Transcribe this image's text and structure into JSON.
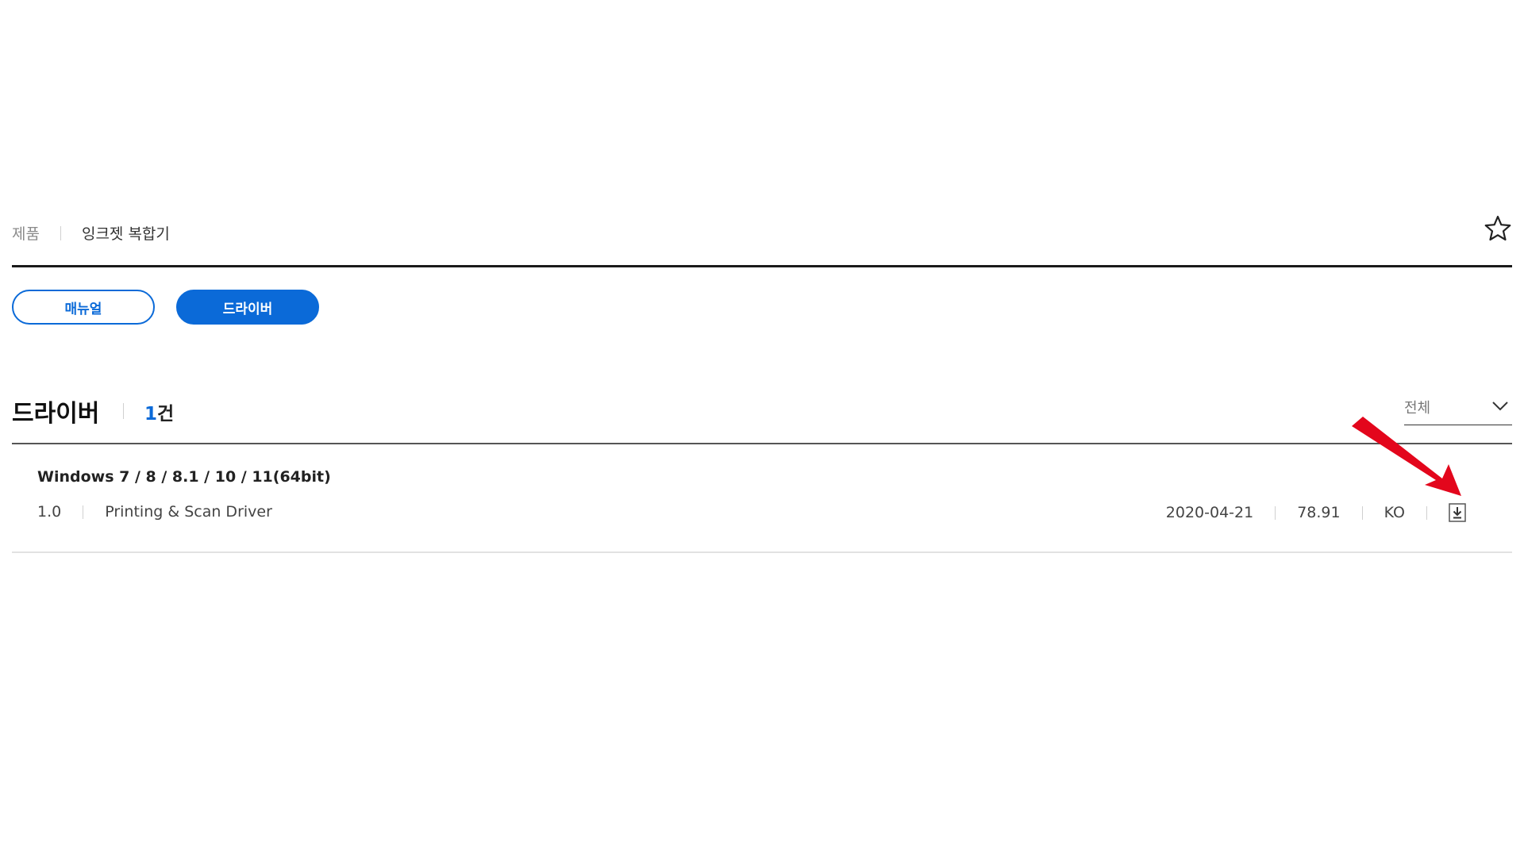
{
  "breadcrumb": {
    "root": "제품",
    "current": "잉크젯 복합기"
  },
  "favorite": {
    "icon": "star-outline-icon"
  },
  "tabs": [
    {
      "label": "매뉴얼",
      "active": false
    },
    {
      "label": "드라이버",
      "active": true
    }
  ],
  "section": {
    "title": "드라이버",
    "count_number": "1",
    "count_unit": "건"
  },
  "filter": {
    "selected": "전체",
    "icon": "chevron-down-icon"
  },
  "driver": {
    "os": "Windows 7 / 8 / 8.1 / 10 / 11(64bit)",
    "version": "1.0",
    "name": "Printing & Scan Driver",
    "date": "2020-04-21",
    "size": "78.91",
    "language": "KO",
    "download_icon": "download-icon"
  },
  "annotation": {
    "icon": "red-arrow-icon",
    "color": "#e3061c"
  },
  "colors": {
    "accent": "#0b6ad8",
    "rule_dark": "#1a1a1a"
  }
}
